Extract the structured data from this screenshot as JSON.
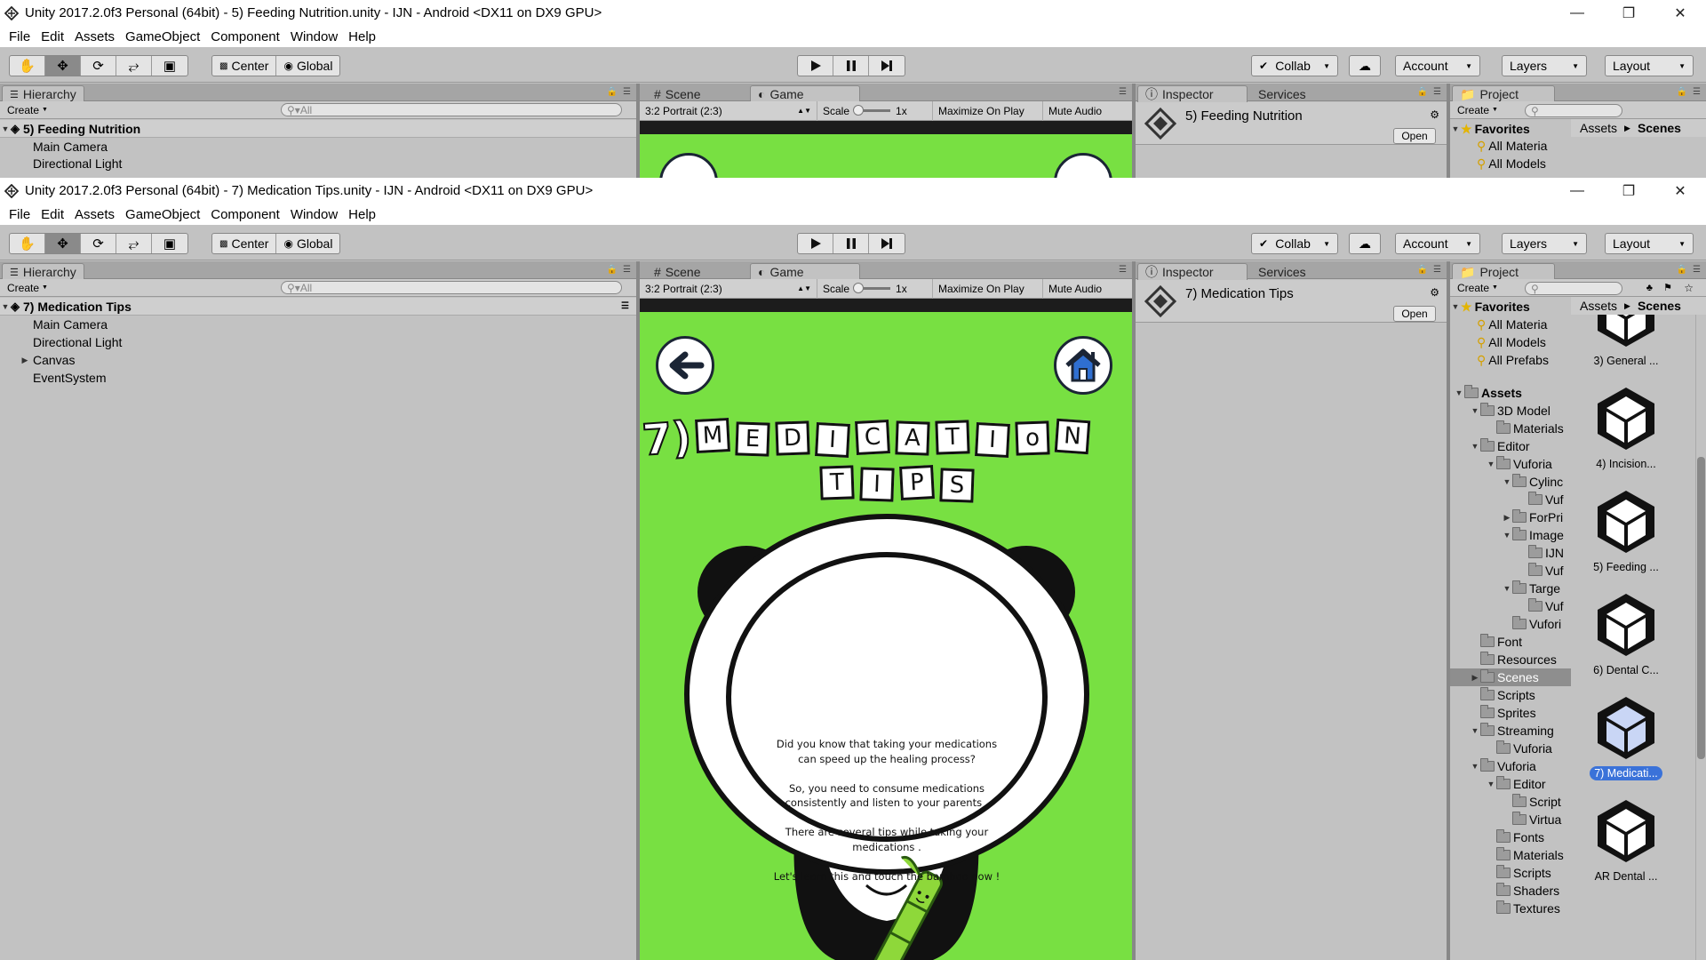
{
  "win1": {
    "title": "Unity 2017.2.0f3 Personal (64bit) - 5) Feeding Nutrition.unity - IJN - Android <DX11 on DX9 GPU>",
    "menu": [
      "File",
      "Edit",
      "Assets",
      "GameObject",
      "Component",
      "Window",
      "Help"
    ],
    "hierarchy_scene": "5) Feeding Nutrition",
    "hierarchy_items": [
      "Main Camera",
      "Directional Light"
    ],
    "inspector_title": "5) Feeding Nutrition",
    "favorites": [
      "All Materia",
      "All Models"
    ]
  },
  "win2": {
    "title": "Unity 2017.2.0f3 Personal (64bit) - 7) Medication Tips.unity - IJN - Android <DX11 on DX9 GPU>",
    "menu": [
      "File",
      "Edit",
      "Assets",
      "GameObject",
      "Component",
      "Window",
      "Help"
    ],
    "hierarchy_scene": "7) Medication Tips",
    "hierarchy_items": [
      {
        "label": "Main Camera",
        "expandable": false
      },
      {
        "label": "Directional Light",
        "expandable": false
      },
      {
        "label": "Canvas",
        "expandable": true
      },
      {
        "label": "EventSystem",
        "expandable": false
      }
    ],
    "inspector_title": "7) Medication Tips",
    "favorites": [
      "All Materia",
      "All Models",
      "All Prefabs"
    ]
  },
  "toolbar": {
    "center": "Center",
    "global": "Global",
    "collab": "Collab",
    "account": "Account",
    "layers": "Layers",
    "layout": "Layout"
  },
  "panels": {
    "hierarchy_tab": "Hierarchy",
    "create": "Create",
    "search_placeholder": "All",
    "scene_tab": "Scene",
    "game_tab": "Game",
    "inspector_tab": "Inspector",
    "services_tab": "Services",
    "project_tab": "Project",
    "open_button": "Open",
    "favorites": "Favorites",
    "breadcrumb": [
      "Assets",
      "Scenes"
    ]
  },
  "game_bar": {
    "aspect": "3:2 Portrait (2:3)",
    "scale_label": "Scale",
    "scale_value": "1x",
    "maximize": "Maximize On Play",
    "mute": "Mute Audio"
  },
  "game": {
    "title_row1_prefix": "7)",
    "title_row1_letters": [
      "M",
      "E",
      "D",
      "I",
      "C",
      "A",
      "T",
      "I",
      "o",
      "N"
    ],
    "title_row2_letters": [
      "T",
      "I",
      "P",
      "S"
    ],
    "bubble_text": "Did you know that taking your medications\ncan speed up the healing process?\n\nSo, you need to consume medications\nconsistently and listen to your parents .\n\nThere are several tips while taking your\nmedications .\n\nLet's learn this and touch the bamboo now !",
    "colors": {
      "background": "#78e042",
      "bamboo": "#8ed83a"
    }
  },
  "project_tree": [
    {
      "label": "Assets",
      "depth": 0,
      "open": true,
      "bold": true
    },
    {
      "label": "3D Model",
      "depth": 1,
      "open": true
    },
    {
      "label": "Materials",
      "depth": 2
    },
    {
      "label": "Editor",
      "depth": 1,
      "open": true
    },
    {
      "label": "Vuforia",
      "depth": 2,
      "open": true
    },
    {
      "label": "Cylinc",
      "depth": 3,
      "open": true
    },
    {
      "label": "Vuf",
      "depth": 4
    },
    {
      "label": "ForPri",
      "depth": 3,
      "closed": true
    },
    {
      "label": "Image",
      "depth": 3,
      "open": true
    },
    {
      "label": "IJN",
      "depth": 4
    },
    {
      "label": "Vuf",
      "depth": 4
    },
    {
      "label": "Targe",
      "depth": 3,
      "open": true
    },
    {
      "label": "Vuf",
      "depth": 4
    },
    {
      "label": "Vufori",
      "depth": 3
    },
    {
      "label": "Font",
      "depth": 1
    },
    {
      "label": "Resources",
      "depth": 1
    },
    {
      "label": "Scenes",
      "depth": 1,
      "closed": true,
      "selected": true
    },
    {
      "label": "Scripts",
      "depth": 1
    },
    {
      "label": "Sprites",
      "depth": 1
    },
    {
      "label": "Streaming",
      "depth": 1,
      "open": true
    },
    {
      "label": "Vuforia",
      "depth": 2
    },
    {
      "label": "Vuforia",
      "depth": 1,
      "open": true
    },
    {
      "label": "Editor",
      "depth": 2,
      "open": true
    },
    {
      "label": "Script",
      "depth": 3
    },
    {
      "label": "Virtua",
      "depth": 3
    },
    {
      "label": "Fonts",
      "depth": 2
    },
    {
      "label": "Materials",
      "depth": 2
    },
    {
      "label": "Scripts",
      "depth": 2
    },
    {
      "label": "Shaders",
      "depth": 2
    },
    {
      "label": "Textures",
      "depth": 2
    }
  ],
  "scenes": [
    {
      "label": "3) General ...",
      "selected": false
    },
    {
      "label": "4) Incision...",
      "selected": false
    },
    {
      "label": "5) Feeding ...",
      "selected": false
    },
    {
      "label": "6) Dental C...",
      "selected": false
    },
    {
      "label": "7) Medicati...",
      "selected": true
    },
    {
      "label": "AR Dental ...",
      "selected": false
    }
  ]
}
